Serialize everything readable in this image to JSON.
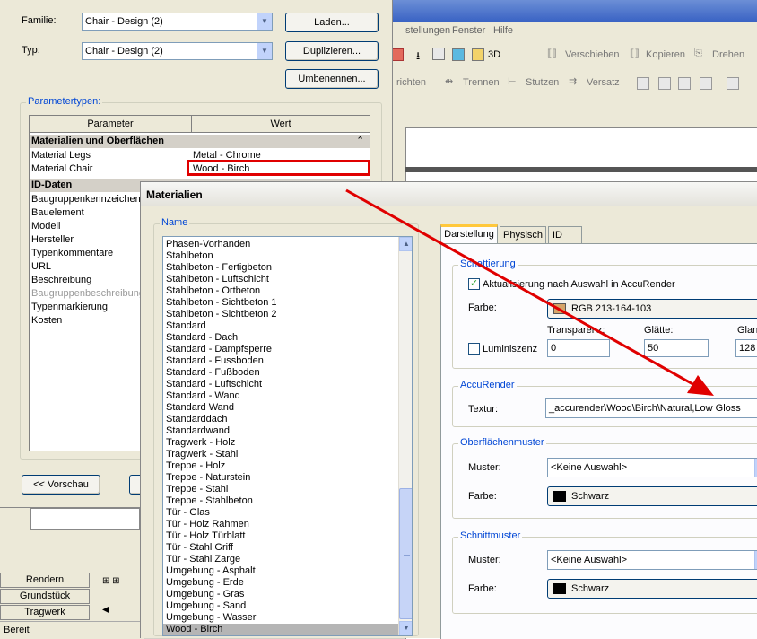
{
  "background_app": {
    "menu": [
      "stellungen",
      "Fenster",
      "Hilfe"
    ],
    "toolbar1": {
      "view_3d": "3D",
      "move": "Verschieben",
      "copy": "Kopieren",
      "rotate": "Drehen"
    },
    "toolbar2": {
      "richten": "richten",
      "split": "Trennen",
      "supports": "Stutzen",
      "offset": "Versatz"
    },
    "left_tabs": [
      "Rendern",
      "Grundstück",
      "Tragwerk"
    ],
    "status": "Bereit"
  },
  "type_dialog": {
    "family_label": "Familie:",
    "family_value": "Chair - Design (2)",
    "type_label": "Typ:",
    "type_value": "Chair - Design (2)",
    "load_button": "Laden...",
    "duplicate_button": "Duplizieren...",
    "rename_button": "Umbenennen...",
    "params_group": "Parametertypen:",
    "col_param": "Parameter",
    "col_value": "Wert",
    "section_materials": "Materialien und Oberflächen",
    "collapse_glyph": "⌃",
    "rows_materials": [
      {
        "name": "Material Legs",
        "value": "Metal - Chrome"
      },
      {
        "name": "Material Chair",
        "value": "Wood - Birch"
      }
    ],
    "section_id": "ID-Daten",
    "rows_id": [
      "Baugruppenkennzeichen",
      "Bauelement",
      "Modell",
      "Hersteller",
      "Typenkommentare",
      "URL",
      "Beschreibung",
      "Baugruppenbeschreibung",
      "Typenmarkierung",
      "Kosten"
    ],
    "preview_button": "<< Vorschau"
  },
  "materials_dialog": {
    "title": "Materialien",
    "name_group": "Name",
    "list": [
      "Phasen-Vorhanden",
      "Stahlbeton",
      "Stahlbeton - Fertigbeton",
      "Stahlbeton - Luftschicht",
      "Stahlbeton - Ortbeton",
      "Stahlbeton - Sichtbeton 1",
      "Stahlbeton - Sichtbeton 2",
      "Standard",
      "Standard - Dach",
      "Standard - Dampfsperre",
      "Standard - Fussboden",
      "Standard - Fußboden",
      "Standard - Luftschicht",
      "Standard - Wand",
      "Standard Wand",
      "Standarddach",
      "Standardwand",
      "Tragwerk - Holz",
      "Tragwerk - Stahl",
      "Treppe - Holz",
      "Treppe - Naturstein",
      "Treppe - Stahl",
      "Treppe - Stahlbeton",
      "Tür - Glas",
      "Tür - Holz Rahmen",
      "Tür - Holz Türblatt",
      "Tür - Stahl Griff",
      "Tür - Stahl Zarge",
      "Umgebung - Asphalt",
      "Umgebung - Erde",
      "Umgebung - Gras",
      "Umgebung - Sand",
      "Umgebung - Wasser",
      "Wood - Birch"
    ],
    "selected": "Wood - Birch",
    "tabs": [
      "Darstellung",
      "Physisch",
      "ID"
    ],
    "shading": {
      "title": "Schattierung",
      "checkbox_label": "Aktualisierung nach Auswahl in AccuRender",
      "color_label": "Farbe:",
      "color_value": "RGB 213-164-103",
      "color_swatch": "#d5a467",
      "transparency_label": "Transparenz:",
      "smoothness_label": "Glätte:",
      "gloss_label": "Glan",
      "luminance_label": "Luminiszenz",
      "transparency_value": "0",
      "smoothness_value": "50",
      "gloss_value": "128"
    },
    "accurender": {
      "title": "AccuRender",
      "texture_label": "Textur:",
      "texture_value": "_accurender\\Wood\\Birch\\Natural,Low Gloss"
    },
    "surface": {
      "title": "Oberflächenmuster",
      "pattern_label": "Muster:",
      "pattern_value": "<Keine Auswahl>",
      "color_label": "Farbe:",
      "color_value": "Schwarz"
    },
    "cut": {
      "title": "Schnittmuster",
      "pattern_label": "Muster:",
      "pattern_value": "<Keine Auswahl>",
      "color_label": "Farbe:",
      "color_value": "Schwarz"
    }
  },
  "colors": {
    "highlight_red": "#e00000",
    "selected_row": "#b5b5b5",
    "tab_active_border": "#ffc83c"
  }
}
